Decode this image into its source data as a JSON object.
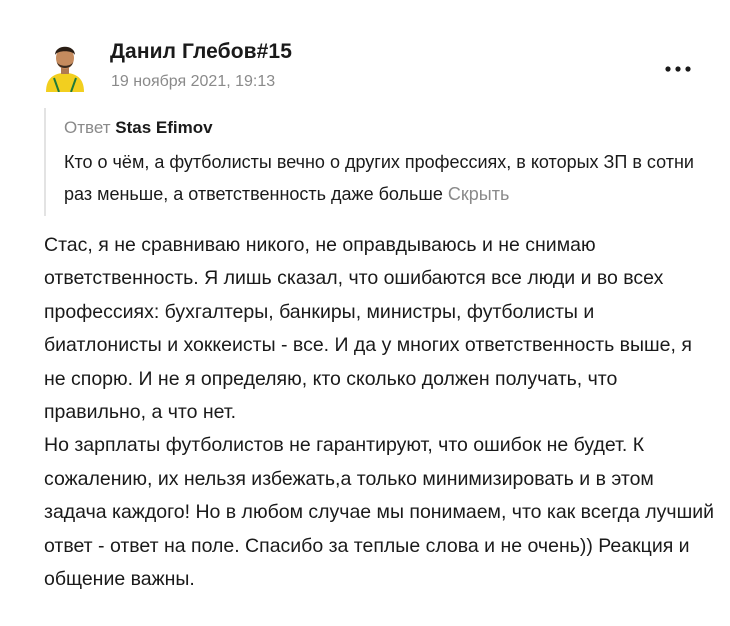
{
  "comment": {
    "author": "Данил Глебов#15",
    "date": "19 ноября 2021, 19:13",
    "reply": {
      "label": "Ответ",
      "to": "Stas Efimov",
      "text": "Кто о чём, а футболисты вечно о других профессиях, в которых ЗП в сотни раз меньше, а ответственность даже больше",
      "hide_label": "Скрыть"
    },
    "paragraphs": [
      "Стас, я не сравниваю никого, не оправдываюсь и не снимаю ответственность. Я лишь сказал, что ошибаются все люди и во всех профессиях: бухгалтеры, банкиры, министры, футболисты и биатлонисты и хоккеисты - все. И да у многих ответственность выше, я не спорю. И не я определяю, кто сколько должен получать, что правильно, а что нет.",
      "Но зарплаты футболистов не гарантируют, что ошибок не будет. К сожалению, их нельзя избежать,а только минимизировать и в этом задача каждого! Но в любом случае мы понимаем, что как всегда лучший ответ - ответ на поле. Спасибо за теплые слова и не очень)) Реакция и общение важны."
    ]
  },
  "icons": {
    "menu": "more-dots-icon",
    "avatar": "user-avatar"
  },
  "colors": {
    "text": "#1a1a1a",
    "muted": "#8a8a8a",
    "quote_border": "#e3e3e3",
    "jersey": "#f2cf1f"
  }
}
